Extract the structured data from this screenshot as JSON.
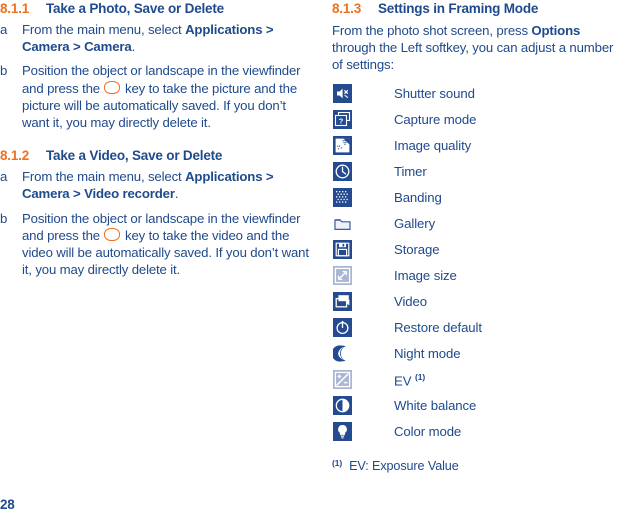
{
  "document": {
    "page_number": "28",
    "colors": {
      "accent_orange": "#f07020",
      "text_blue": "#1f4a8c",
      "icon_dark": "#244a8f",
      "icon_light_bg": "#aab6d4"
    }
  },
  "left_column": {
    "section_811": {
      "number": "8.1.1",
      "title": "Take a Photo, Save or Delete",
      "items": [
        {
          "marker": "a",
          "text_pre": "From the main menu, select ",
          "bold": "Applications > Camera > Camera",
          "text_post": "."
        },
        {
          "marker": "b",
          "text_pre": "Position the object or landscape in the viewfinder and press the ",
          "text_post": " key to take the picture and the picture will be automatically saved. If you don’t want it, you may directly delete it."
        }
      ]
    },
    "section_812": {
      "number": "8.1.2",
      "title": "Take a Video, Save or Delete",
      "items": [
        {
          "marker": "a",
          "text_pre": "From the main menu, select ",
          "bold": "Applications > Camera > Video recorder",
          "text_post": "."
        },
        {
          "marker": "b",
          "text_pre": "Position the object or landscape in the viewfinder and press the ",
          "text_post": " key to take the video and the video will be automatically saved. If you don’t want it, you may directly delete it."
        }
      ]
    }
  },
  "right_column": {
    "section_813": {
      "number": "8.1.3",
      "title": "Settings in Framing Mode"
    },
    "intro": {
      "text_pre": "From the photo shot screen, press ",
      "bold": "Options",
      "text_post": " through the Left softkey, you can adjust a number of settings:"
    },
    "settings": [
      {
        "icon": "speaker-icon",
        "label": "Shutter sound",
        "footnote": ""
      },
      {
        "icon": "capture-mode-icon",
        "label": "Capture mode",
        "footnote": ""
      },
      {
        "icon": "image-quality-icon",
        "label": "Image quality",
        "footnote": ""
      },
      {
        "icon": "clock-icon",
        "label": "Timer",
        "footnote": ""
      },
      {
        "icon": "banding-icon",
        "label": "Banding",
        "footnote": ""
      },
      {
        "icon": "folder-icon",
        "label": "Gallery",
        "footnote": ""
      },
      {
        "icon": "floppy-disk-icon",
        "label": "Storage",
        "footnote": ""
      },
      {
        "icon": "resize-arrow-icon",
        "label": "Image size",
        "footnote": ""
      },
      {
        "icon": "video-camera-icon",
        "label": "Video",
        "footnote": ""
      },
      {
        "icon": "restore-default-icon",
        "label": "Restore default",
        "footnote": ""
      },
      {
        "icon": "moon-icon",
        "label": "Night mode",
        "footnote": ""
      },
      {
        "icon": "exposure-icon",
        "label": "EV",
        "footnote": "(1)"
      },
      {
        "icon": "contrast-circle-icon",
        "label": "White balance",
        "footnote": ""
      },
      {
        "icon": "lightbulb-icon",
        "label": "Color mode",
        "footnote": ""
      }
    ],
    "footnote": {
      "marker": "(1)",
      "text": "EV: Exposure Value"
    }
  }
}
